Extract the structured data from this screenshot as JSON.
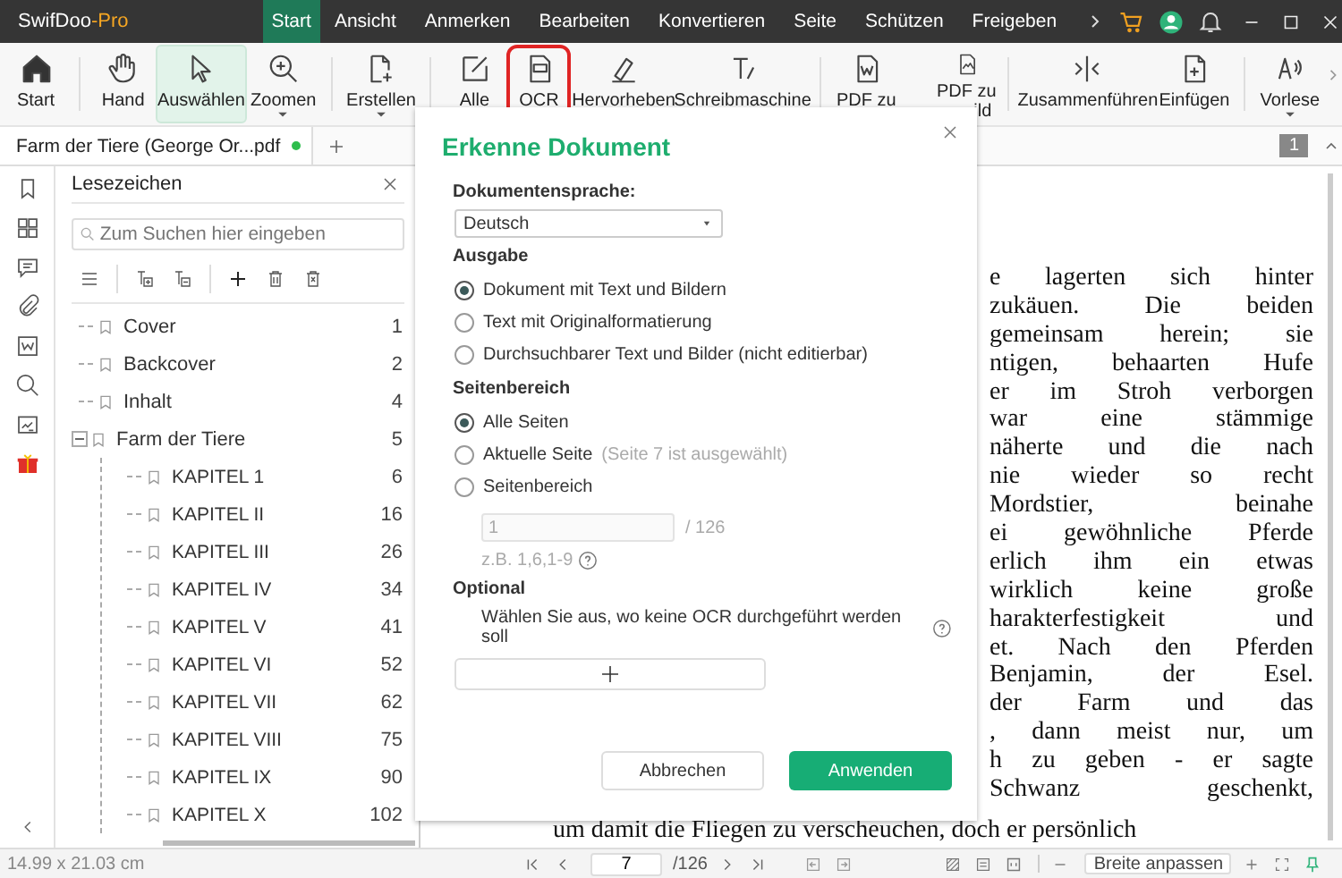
{
  "title_bar": {
    "app_name": "SwifDoo",
    "app_suffix": "-Pro",
    "menu": [
      {
        "label": "Start",
        "selected": true
      },
      {
        "label": "Ansicht",
        "selected": false
      },
      {
        "label": "Anmerken",
        "selected": false
      },
      {
        "label": "Bearbeiten",
        "selected": false
      },
      {
        "label": "Konvertieren",
        "selected": false
      },
      {
        "label": "Seite",
        "selected": false
      },
      {
        "label": "Schützen",
        "selected": false
      },
      {
        "label": "Freigeben",
        "selected": false
      }
    ]
  },
  "toolbar": {
    "tools": [
      {
        "label": "Start",
        "kind": "home",
        "selected": false,
        "highlighted": false,
        "caret": false,
        "group_end": true
      },
      {
        "label": "Hand",
        "kind": "hand",
        "selected": false,
        "highlighted": false,
        "caret": false,
        "group_end": false
      },
      {
        "label": "Auswählen",
        "kind": "cursor",
        "selected": true,
        "highlighted": false,
        "caret": false,
        "group_end": false
      },
      {
        "label": "Zoomen",
        "kind": "zoom",
        "selected": false,
        "highlighted": false,
        "caret": true,
        "group_end": true
      },
      {
        "label": "Erstellen",
        "kind": "create",
        "selected": false,
        "highlighted": false,
        "caret": true,
        "group_end": true
      },
      {
        "label": "Alle",
        "kind": "edit",
        "selected": false,
        "highlighted": false,
        "caret": false,
        "group_end": false
      },
      {
        "label": "OCR",
        "kind": "ocr",
        "selected": false,
        "highlighted": true,
        "caret": false,
        "group_end": false
      },
      {
        "label": "Hervorheben",
        "kind": "highlight",
        "selected": false,
        "highlighted": false,
        "caret": false,
        "group_end": false
      },
      {
        "label": "Schreibmaschine",
        "kind": "type",
        "selected": false,
        "highlighted": false,
        "caret": false,
        "group_end": true
      },
      {
        "label": "PDF zu",
        "kind": "pdfword",
        "selected": false,
        "highlighted": false,
        "caret": false,
        "group_end": false
      },
      {
        "label": "PDF zu",
        "label2": "ild",
        "kind": "pdfimage",
        "selected": false,
        "highlighted": false,
        "caret": false,
        "group_end": true
      },
      {
        "label": "Zusammenführen",
        "kind": "merge",
        "selected": false,
        "highlighted": false,
        "caret": false,
        "group_end": false
      },
      {
        "label": "Einfügen",
        "kind": "insert",
        "selected": false,
        "highlighted": false,
        "caret": false,
        "group_end": true
      },
      {
        "label": "Vorlese",
        "kind": "speaker",
        "selected": false,
        "highlighted": false,
        "caret": true,
        "group_end": false
      }
    ]
  },
  "document_tab": {
    "label": "Farm der Tiere (George Or...pdf",
    "unsaved": true
  },
  "page_badge": "1",
  "sidebar": {
    "title": "Lesezeichen",
    "search": {
      "placeholder": "Zum Suchen hier eingeben"
    },
    "bookmarks": [
      {
        "name": "Cover",
        "page": "1"
      },
      {
        "name": "Backcover",
        "page": "2"
      },
      {
        "name": "Inhalt",
        "page": "4"
      },
      {
        "name": "Farm der Tiere",
        "page": "5",
        "expanded": true,
        "children": [
          {
            "name": "KAPITEL 1",
            "page": "6"
          },
          {
            "name": "KAPITEL II",
            "page": "16"
          },
          {
            "name": "KAPITEL III",
            "page": "26"
          },
          {
            "name": "KAPITEL IV",
            "page": "34"
          },
          {
            "name": "KAPITEL V",
            "page": "41"
          },
          {
            "name": "KAPITEL VI",
            "page": "52"
          },
          {
            "name": "KAPITEL VII",
            "page": "62"
          },
          {
            "name": "KAPITEL VIII",
            "page": "75"
          },
          {
            "name": "KAPITEL IX",
            "page": "90"
          },
          {
            "name": "KAPITEL X",
            "page": "102"
          }
        ]
      }
    ]
  },
  "page_text": [
    "e lagerten sich hinter",
    "zukäuen. Die beiden",
    "gemeinsam herein; sie",
    "ntigen, behaarten Hufe",
    "er im Stroh verborgen",
    "war eine stämmige",
    "näherte und die nach",
    "nie wieder so recht",
    "Mordstier, beinahe",
    "ei gewöhnliche Pferde",
    "erlich ihm ein etwas",
    "wirklich keine große",
    "harakterfestigkeit und",
    "et. Nach den Pferden",
    "Benjamin, der Esel.",
    "der Farm und das",
    ", dann meist nur, um",
    "h zu geben - er sagte",
    "Schwanz geschenkt,"
  ],
  "page_text_bottom": "um damit die Fliegen zu verscheuchen, doch er persönlich",
  "dialog": {
    "title": "Erkenne Dokument",
    "language": {
      "label": "Dokumentensprache:",
      "value": "Deutsch"
    },
    "output": {
      "heading": "Ausgabe",
      "options": [
        {
          "label": "Dokument mit Text und Bildern",
          "selected": true
        },
        {
          "label": "Text mit Originalformatierung",
          "selected": false
        },
        {
          "label": "Durchsuchbarer Text und Bilder (nicht editierbar)",
          "selected": false
        }
      ]
    },
    "range": {
      "heading": "Seitenbereich",
      "options": [
        {
          "label": "Alle Seiten",
          "selected": true
        },
        {
          "label": "Aktuelle Seite",
          "note": "(Seite 7 ist ausgewählt)",
          "selected": false
        },
        {
          "label": "Seitenbereich",
          "selected": false
        }
      ],
      "field": {
        "value": "1",
        "disabled": true
      },
      "total": "/ 126",
      "hint": "z.B. 1,6,1-9"
    },
    "optional": {
      "heading": "Optional",
      "text": "Wählen Sie aus, wo keine OCR durchgeführt werden soll"
    },
    "buttons": {
      "cancel": "Abbrechen",
      "apply": "Anwenden"
    }
  },
  "status_bar": {
    "page_size": "14.99 x 21.03 cm",
    "page": "7",
    "total": "/126",
    "zoom": "Breite anpassen"
  }
}
